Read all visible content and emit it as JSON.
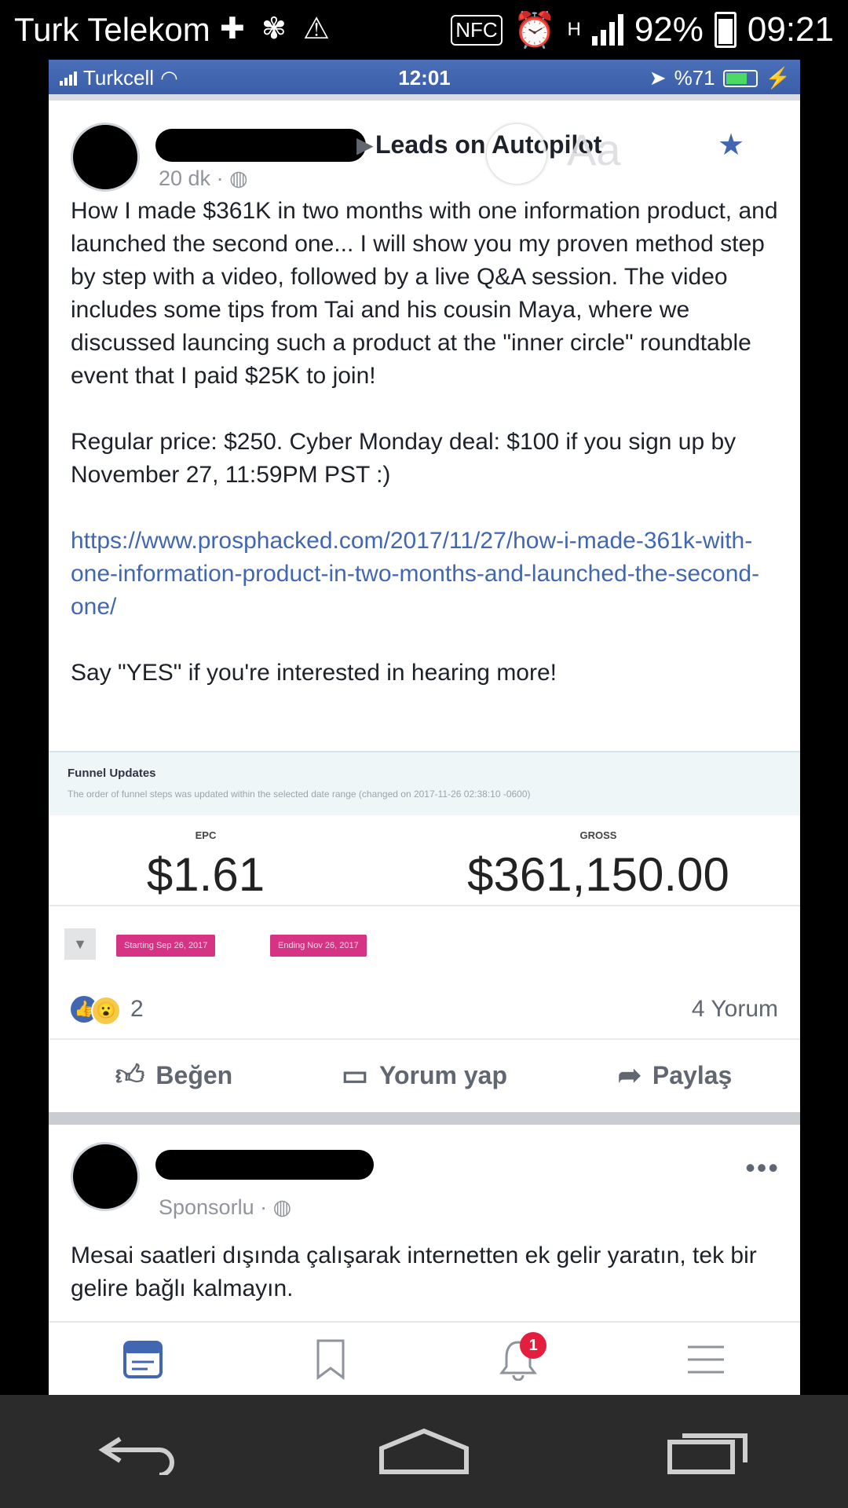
{
  "device_status": {
    "carrier": "Turk Telekom",
    "battery": "92%",
    "time": "09:21",
    "nfc": "NFC",
    "network": "H"
  },
  "ios_status": {
    "carrier": "Turkcell",
    "time": "12:01",
    "battery": "%71"
  },
  "post": {
    "group": "Leads on Autopilot",
    "time": "20 dk",
    "paragraphs": [
      "How I made $361K in two months with one information product, and launched the second one... I will show you my proven method step by step with a video, followed by a live Q&A session. The video includes some tips from Tai and his cousin Maya, where we discussed launcing such a product at the \"inner circle\" roundtable event that I paid $25K to join!",
      "Regular price: $250. Cyber Monday deal: $100 if you sign up by November 27, 11:59PM PST :)"
    ],
    "link": "https://www.prosphacked.com/2017/11/27/how-i-made-361k-with-one-information-product-in-two-months-and-launched-the-second-one/",
    "closing": "Say \"YES\" if you're interested in hearing more!",
    "reaction_count": "2",
    "comment_count": "4 Yorum"
  },
  "screenshot": {
    "funnel_title": "Funnel Updates",
    "funnel_subtitle": "The order of funnel steps was updated within the selected date range (changed on 2017-11-26 02:38:10 -0600)",
    "epc_label": "EPC",
    "epc_value": "$1.61",
    "gross_label": "GROSS",
    "gross_value": "$361,150.00",
    "starting": "Starting  Sep 26, 2017",
    "ending": "Ending  Nov 26, 2017"
  },
  "actions": {
    "like": "Beğen",
    "comment": "Yorum yap",
    "share": "Paylaş"
  },
  "post2": {
    "label": "Sponsorlu",
    "text": "Mesai saatleri dışında çalışarak internetten ek gelir yaratın, tek bir gelire bağlı kalmayın."
  },
  "tabbar": {
    "notification_badge": "1"
  }
}
